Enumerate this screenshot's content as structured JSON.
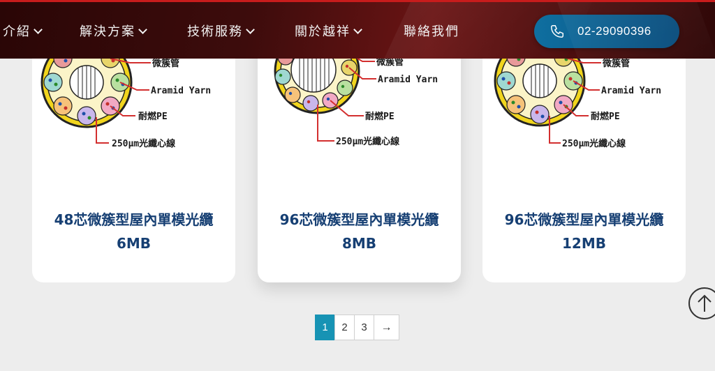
{
  "nav": {
    "items": [
      {
        "label": "介紹"
      },
      {
        "label": "解決方案"
      },
      {
        "label": "技術服務"
      },
      {
        "label": "關於越祥"
      },
      {
        "label": "聯絡我們"
      }
    ],
    "phone": "02-29090396"
  },
  "diagram_labels": {
    "tube": "微簇管",
    "aramid": "Aramid Yarn",
    "pe": "耐燃PE",
    "fiber": "250μm光纖心線"
  },
  "cards": [
    {
      "title": "48芯微簇型屋內單模光纜6MB"
    },
    {
      "title": "96芯微簇型屋內單模光纜8MB"
    },
    {
      "title": "96芯微簇型屋內單模光纜12MB"
    }
  ],
  "pagination": {
    "pages": [
      "1",
      "2",
      "3"
    ],
    "current": "1",
    "next": "→"
  },
  "colors": {
    "header_bg": "#3d0c0c",
    "phone_button": "#0a5f8f",
    "title_text": "#163f73",
    "active_page": "#1793b4"
  }
}
